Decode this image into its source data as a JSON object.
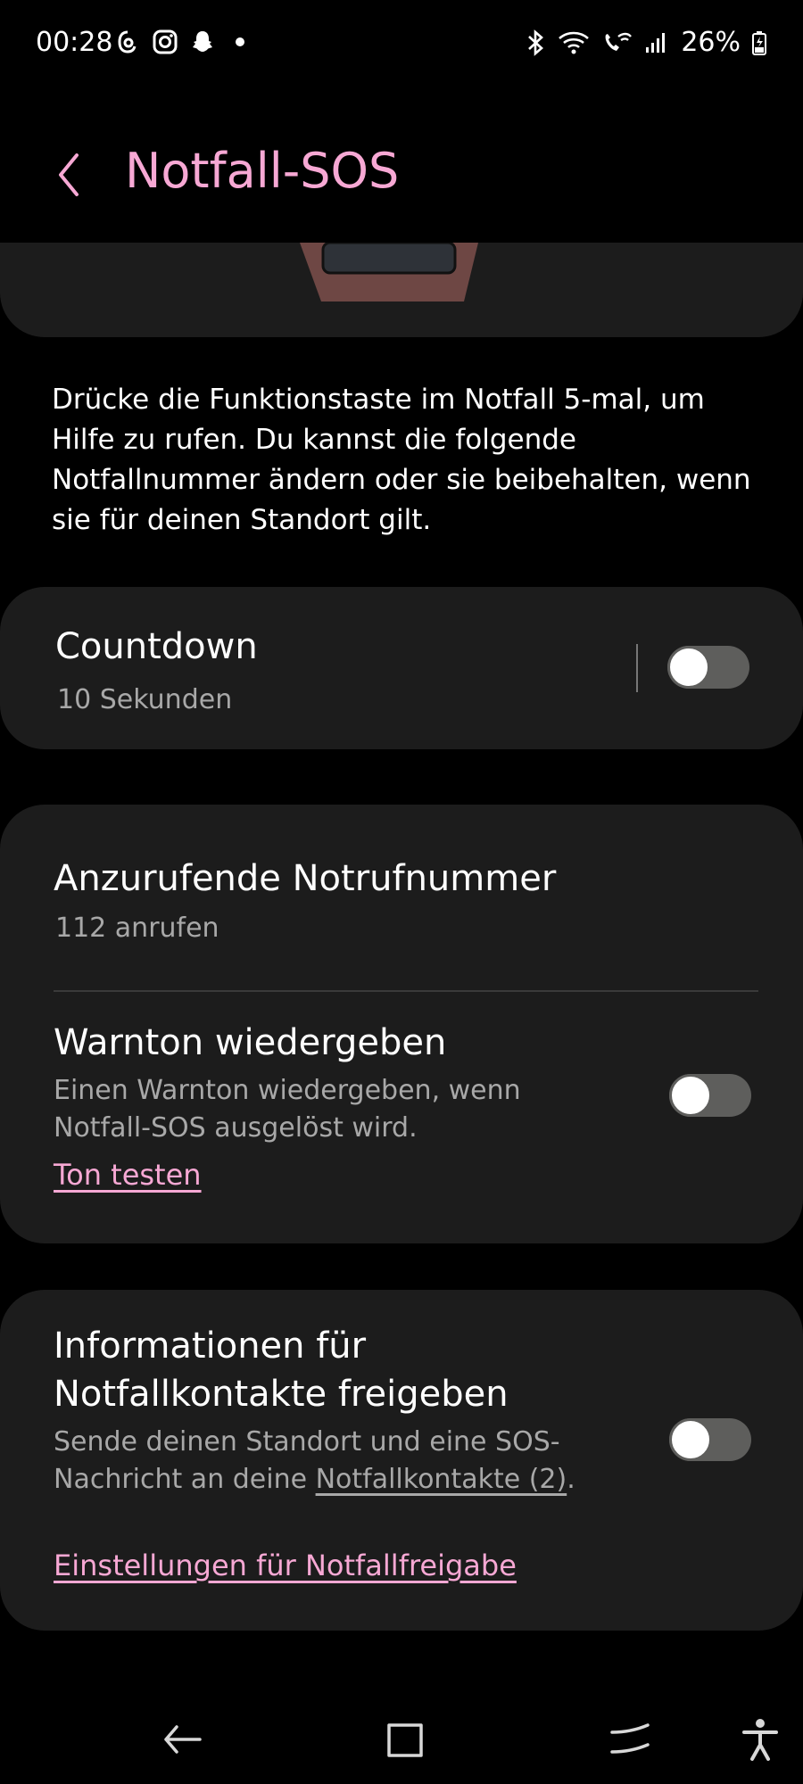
{
  "status_bar": {
    "time": "00:28",
    "battery": "26%",
    "icons_left": [
      "threads-icon",
      "instagram-icon",
      "snapchat-icon",
      "dot-icon"
    ],
    "icons_right": [
      "bluetooth-icon",
      "wifi-icon",
      "wifi-call-icon",
      "signal-icon",
      "battery-icon"
    ]
  },
  "header": {
    "title": "Notfall-SOS",
    "back_icon": "chevron-left-icon"
  },
  "description": "Drücke die Funktionstaste im Notfall 5-mal, um Hilfe zu rufen. Du kannst die folgende Notfallnummer ändern oder sie beibehalten, wenn sie für deinen Standort gilt.",
  "countdown": {
    "title": "Countdown",
    "subtitle": "10 Sekunden",
    "enabled": false
  },
  "emergency_number": {
    "title": "Anzurufende Notrufnummer",
    "subtitle": "112 anrufen"
  },
  "warning_tone": {
    "title": "Warnton wiedergeben",
    "subtitle": "Einen Warnton wiedergeben, wenn Notfall-SOS ausgelöst wird.",
    "link": "Ton testen",
    "enabled": false
  },
  "share_info": {
    "title_line1": "Informationen für",
    "title_line2": "Notfallkontakte freigeben",
    "subtitle_prefix": "Sende deinen Standort und eine SOS-Nachricht an deine ",
    "subtitle_link": "Notfallkontakte (2)",
    "subtitle_suffix": ".",
    "link": "Einstellungen für Notfallfreigabe",
    "enabled": false
  },
  "colors": {
    "accent": "#f7a8d4",
    "card": "#1c1c1c",
    "toggle_off": "#5e5e5c"
  },
  "nav_bar": {
    "icons": [
      "back-icon",
      "home-icon",
      "recents-icon",
      "accessibility-icon"
    ]
  }
}
